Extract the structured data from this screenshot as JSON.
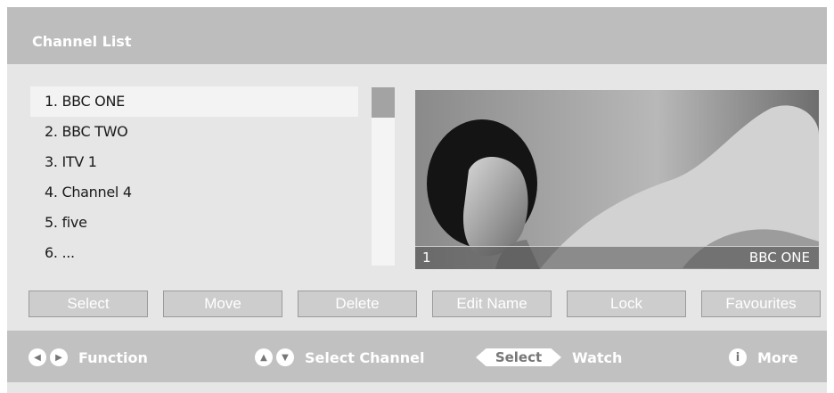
{
  "header": {
    "title": "Channel List"
  },
  "channels": [
    "1. BBC ONE",
    "2. BBC TWO",
    "3. ITV 1",
    "4. Channel 4",
    "5. five",
    "6. ..."
  ],
  "preview": {
    "number": "1",
    "name": "BBC ONE"
  },
  "buttons": {
    "select": "Select",
    "move": "Move",
    "delete": "Delete",
    "edit_name": "Edit Name",
    "lock": "Lock",
    "favourites": "Favourites"
  },
  "footer": {
    "function_label": "Function",
    "select_channel_label": "Select Channel",
    "select_key": "Select",
    "watch_label": "Watch",
    "info_key": "i",
    "more_label": "More"
  },
  "icons": [
    "left-arrow-icon",
    "right-arrow-icon",
    "up-arrow-icon",
    "down-arrow-icon",
    "info-icon"
  ],
  "colors": {
    "header_bg": "#bdbdbd",
    "body_bg": "#e6e6e6",
    "selected_row": "#f3f3f3",
    "button_bg": "#cdcdcd"
  }
}
